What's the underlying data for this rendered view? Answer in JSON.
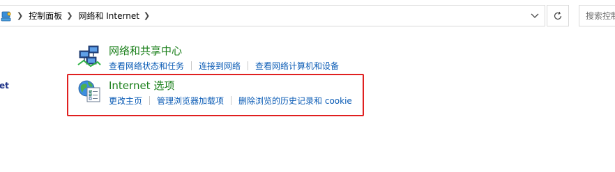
{
  "address_bar": {
    "breadcrumbs": [
      "控制面板",
      "网络和 Internet"
    ],
    "search_placeholder": "搜索控制面板"
  },
  "left_pane": {
    "fragment_text": "et"
  },
  "categories": [
    {
      "title": "网络和共享中心",
      "icon": "network-sharing-center-icon",
      "links": [
        "查看网络状态和任务",
        "连接到网络",
        "查看网络计算机和设备"
      ]
    },
    {
      "title": "Internet 选项",
      "icon": "internet-options-icon",
      "links": [
        "更改主页",
        "管理浏览器加载项",
        "删除浏览的历史记录和 cookie"
      ]
    }
  ],
  "colors": {
    "title_green": "#1a7f1a",
    "link_blue": "#0a5bb5",
    "highlight_red": "#e02020"
  }
}
